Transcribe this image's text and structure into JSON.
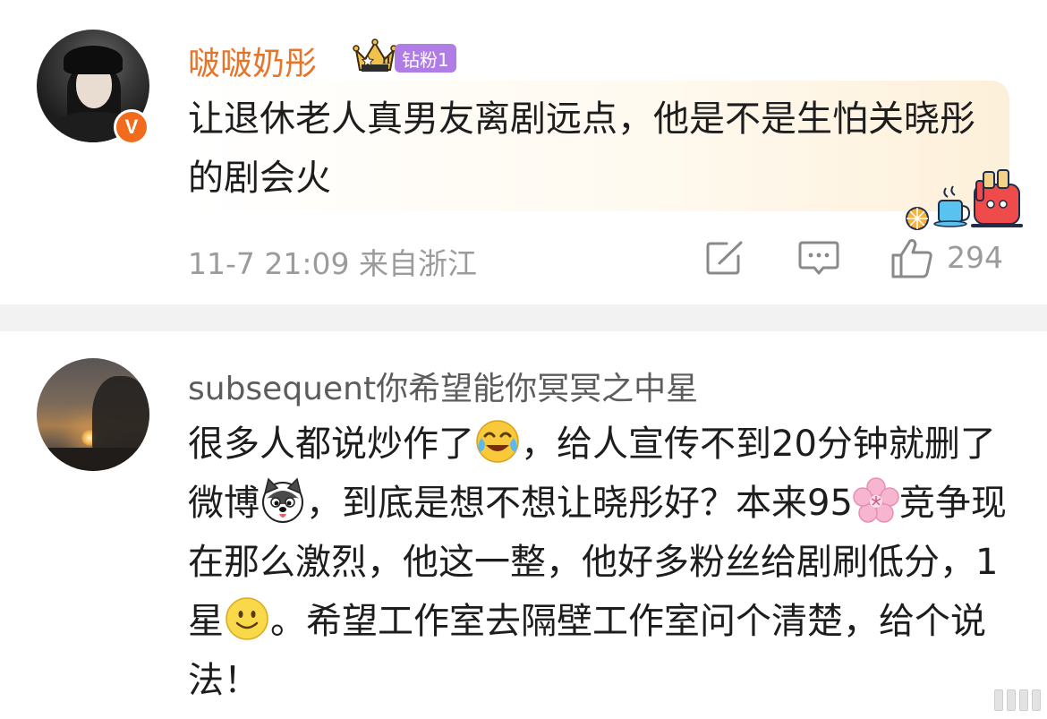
{
  "comment1": {
    "username": "啵啵奶彤",
    "fan_badge": "钻粉1",
    "crown_level": "II",
    "verified_badge": "V",
    "text": "让退休老人真男友离剧远点，他是不是生怕关晓彤的剧会火",
    "timestamp": "11-7 21:09",
    "location": "来自浙江",
    "likes": "294",
    "icons": [
      "share-edit-icon",
      "comment-icon",
      "like-thumb-icon"
    ]
  },
  "comment2": {
    "username": "subsequent你希望能你冥冥之中星",
    "segments": [
      "很多人都说炒作了",
      "，给人宣传不到20分钟就删了微博",
      "，到底是想不想让晓彤好？本来95",
      "竞争现在那么激烈，他这一整，他好多粉丝给剧刷低分，1星",
      "。希望工作室去隔壁工作室问个清楚，给个说法！"
    ],
    "emojis": [
      "laugh-cry-emoji",
      "husky-dog-emoji",
      "cherry-blossom-emoji",
      "smile-emoji"
    ]
  },
  "colors": {
    "username_orange": "#e8742a",
    "fan_badge_purple": "#b07de6",
    "meta_gray": "#9b9b9b",
    "divider": "#f2f2f2",
    "verified_orange": "#f26b1d"
  }
}
